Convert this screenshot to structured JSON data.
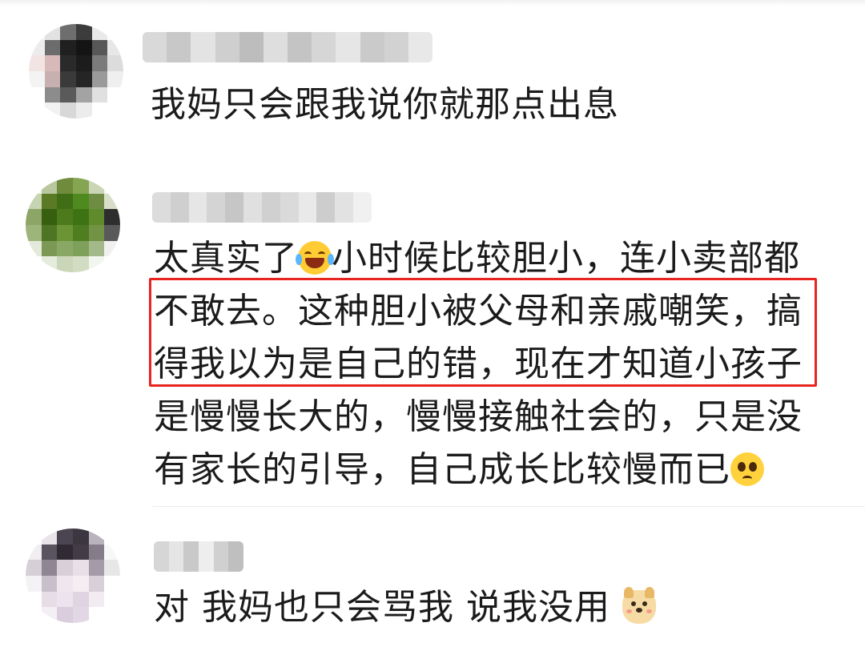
{
  "comments": [
    {
      "avatar_colors": [
        "#f4f4f4",
        "#e2e2e2",
        "#6e6e6e",
        "#3c3c3c",
        "#e9e9e9",
        "#fafafa",
        "#ececec",
        "#6c6c6c",
        "#202020",
        "#141414",
        "#575757",
        "#e7e7e7",
        "#f3e4e4",
        "#d8b9b9",
        "#2a2a2a",
        "#1c1c1c",
        "#7b7b7b",
        "#dcdcdc",
        "#f3f3f3",
        "#c8b0b0",
        "#3a3a3a",
        "#252525",
        "#9a9a9a",
        "#efefef",
        "#ffffff",
        "#8c8c8c",
        "#5a5a5a",
        "#a3a3a3",
        "#e0e0e0",
        "#ffffff",
        "#ffffff",
        "#f2f2f2",
        "#d8d8d8",
        "#ececec",
        "#ffffff",
        "#ffffff"
      ],
      "username_colors": [
        "#d9d9d9",
        "#c8c8c8",
        "#e3e3e3",
        "#cfcfcf",
        "#bdbdbd",
        "#dedede",
        "#c4c4c4",
        "#d6d6d6",
        "#e6e6e6",
        "#cacaca",
        "#d2d2d2",
        "#e8e8e8"
      ],
      "lines": [
        "我妈只会跟我说你就那点出息"
      ]
    },
    {
      "avatar_colors": [
        "#f3f5ee",
        "#b8c79e",
        "#6f8b3b",
        "#86a552",
        "#c9d5b4",
        "#f6f7f2",
        "#c7d4b2",
        "#5b7a25",
        "#3f6e16",
        "#4f8a1f",
        "#6e8d43",
        "#d7dfc8",
        "#8da567",
        "#365f10",
        "#4c7a1c",
        "#3d7312",
        "#5f8b2c",
        "#2e2e2e",
        "#9db57b",
        "#4d7524",
        "#6b9435",
        "#4f7e20",
        "#719343",
        "#595959",
        "#e4eadb",
        "#7b9955",
        "#8aa865",
        "#7ea05a",
        "#a3b98a",
        "#f0f0f0",
        "#ffffff",
        "#e6ecdd",
        "#c9d6b7",
        "#d2dcc2",
        "#f3f5ef",
        "#ffffff"
      ],
      "username_colors": [
        "#dcdcdc",
        "#cfcfcf",
        "#e6e6e6",
        "#d4d4d4",
        "#c6c6c6",
        "#e0e0e0",
        "#d0d0d0",
        "#dadada",
        "#e9e9e9",
        "#cdcdcd",
        "#e2e2e2",
        "#f0f0f0"
      ],
      "lines": [
        {
          "before": "太真实了",
          "emoji": "laughing-crying-emoji",
          "after": "小时候比较胆小，连小卖部都"
        },
        {
          "text": "不敢去。这种胆小被父母和亲戚嘲笑，搞"
        },
        {
          "text": "得我以为是自己的错，现在才知道小孩子"
        },
        {
          "text": "是慢慢长大的，慢慢接触社会的，只是没"
        },
        {
          "before": "有家长的引导，自己成长比较慢而已",
          "emoji": "pleading-face-emoji",
          "after": ""
        }
      ],
      "highlight_color": "#e8241e"
    },
    {
      "avatar_colors": [
        "#ffffff",
        "#e8e4ea",
        "#4a4550",
        "#3c3640",
        "#b9b3bd",
        "#ffffff",
        "#f1eef2",
        "#5a5360",
        "#2f2a33",
        "#433c47",
        "#847c89",
        "#f7f7f7",
        "#d5cfd8",
        "#8e8693",
        "#d8cfd9",
        "#e9dfe8",
        "#a49aa8",
        "#e7e7e7",
        "#f5f2f6",
        "#c9bfcb",
        "#f0e6ee",
        "#f6edf3",
        "#d9cfd9",
        "#ffffff",
        "#ffffff",
        "#e6dde6",
        "#ede3ee",
        "#e0d4e2",
        "#f2ecf2",
        "#ffffff",
        "#ffffff",
        "#f4eff5",
        "#dacdde",
        "#e2d7e4",
        "#ffffff",
        "#ffffff"
      ],
      "username_colors": [
        "#d6d6d6",
        "#e5e5e5",
        "#c9c9c9",
        "#eeeeee",
        "#d0d0d0",
        "#bfbfbf"
      ],
      "lines": [
        {
          "before": "对 我妈也只会骂我 说我没用 ",
          "emoji": "dog-emoji",
          "after": ""
        }
      ]
    }
  ]
}
